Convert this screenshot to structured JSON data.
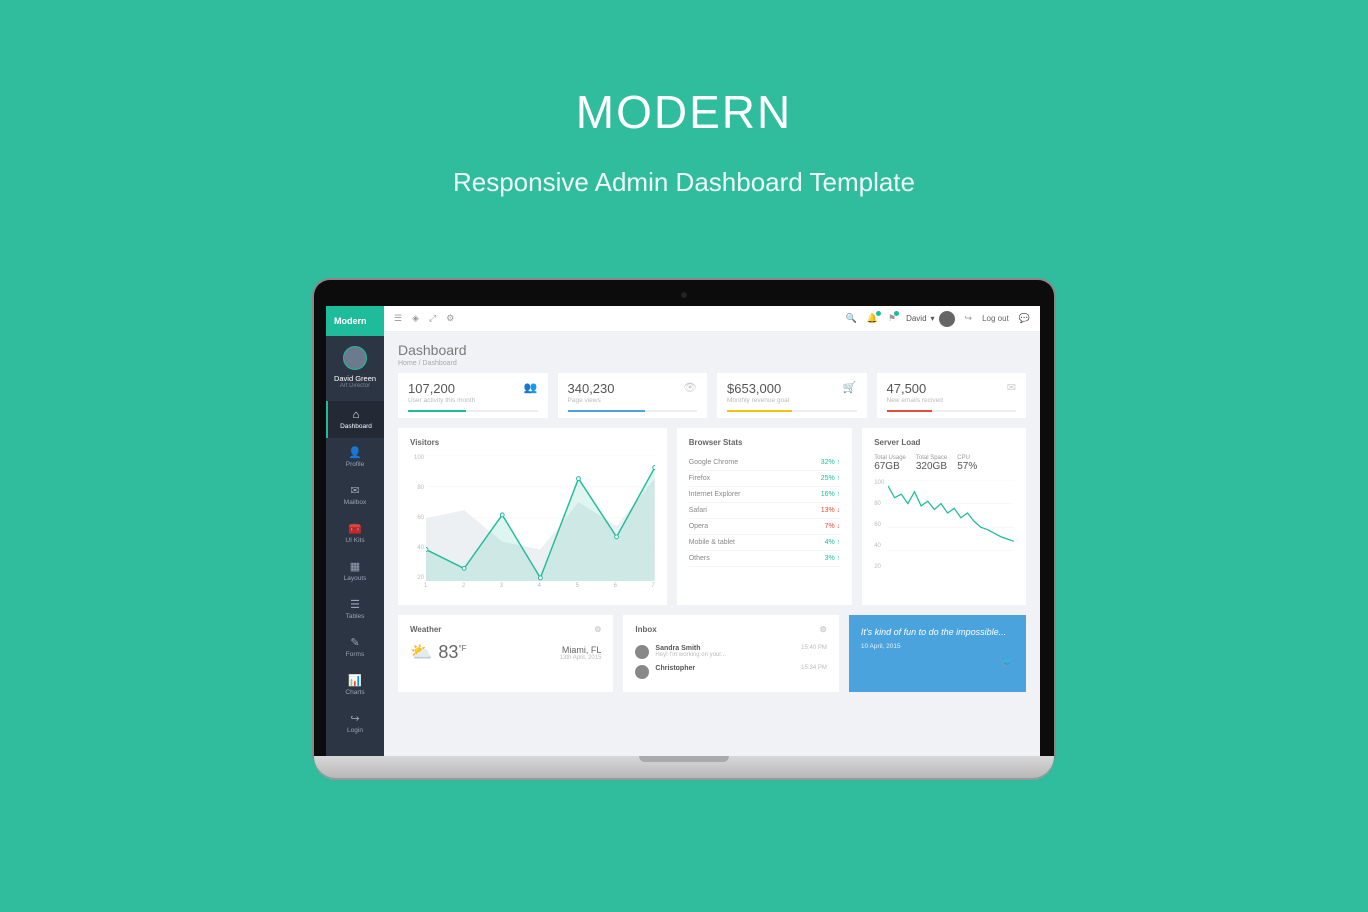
{
  "hero": {
    "title": "MODERN",
    "subtitle": "Responsive Admin Dashboard Template"
  },
  "brand": "Modern",
  "profile": {
    "name": "David Green",
    "role": "Art Director"
  },
  "nav": [
    {
      "label": "Dashboard",
      "icon": "⌂"
    },
    {
      "label": "Profile",
      "icon": "👤"
    },
    {
      "label": "Mailbox",
      "icon": "✉"
    },
    {
      "label": "UI Kits",
      "icon": "🧰"
    },
    {
      "label": "Layouts",
      "icon": "▦"
    },
    {
      "label": "Tables",
      "icon": "☰"
    },
    {
      "label": "Forms",
      "icon": "✎"
    },
    {
      "label": "Charts",
      "icon": "📊"
    },
    {
      "label": "Login",
      "icon": "↪"
    }
  ],
  "topbar": {
    "user": "David",
    "logout": "Log out"
  },
  "page": {
    "title": "Dashboard",
    "breadcrumb_home": "Home",
    "breadcrumb_current": "Dashboard"
  },
  "stats": [
    {
      "value": "107,200",
      "label": "User activity this month",
      "color": "#1fbc9c",
      "pct": 45
    },
    {
      "value": "340,230",
      "label": "Page views",
      "color": "#4ba3dd",
      "pct": 60
    },
    {
      "value": "$653,000",
      "label": "Monthly revenue goal",
      "color": "#f1c40f",
      "pct": 50
    },
    {
      "value": "47,500",
      "label": "New emails recived",
      "color": "#e74c3c",
      "pct": 35
    }
  ],
  "visitors": {
    "title": "Visitors"
  },
  "browsers": {
    "title": "Browser Stats",
    "items": [
      {
        "name": "Google Chrome",
        "pct": "32%",
        "trend": "up"
      },
      {
        "name": "Firefox",
        "pct": "25%",
        "trend": "up"
      },
      {
        "name": "Internet Explorer",
        "pct": "16%",
        "trend": "up"
      },
      {
        "name": "Safari",
        "pct": "13%",
        "trend": "down"
      },
      {
        "name": "Opera",
        "pct": "7%",
        "trend": "down"
      },
      {
        "name": "Mobile & tablet",
        "pct": "4%",
        "trend": "up"
      },
      {
        "name": "Others",
        "pct": "3%",
        "trend": "up"
      }
    ]
  },
  "server": {
    "title": "Server Load",
    "usage_label": "Total Usage",
    "usage": "67GB",
    "space_label": "Total Space",
    "space": "320GB",
    "cpu_label": "CPU",
    "cpu": "57%"
  },
  "weather": {
    "title": "Weather",
    "temp": "83",
    "unit": "°F",
    "city": "Miami, FL",
    "date": "13th April, 2015"
  },
  "inbox": {
    "title": "Inbox",
    "messages": [
      {
        "name": "Sandra Smith",
        "text": "Hey! I'm working on your...",
        "time": "15:40 PM"
      },
      {
        "name": "Christopher",
        "text": "",
        "time": "15:34 PM"
      }
    ]
  },
  "quote": {
    "text": "It's kind of fun to do the impossible...",
    "date": "10 April, 2015"
  },
  "chart_data": [
    {
      "type": "area",
      "title": "Visitors",
      "x": [
        1,
        2,
        3,
        4,
        5,
        6,
        7
      ],
      "series": [
        {
          "name": "secondary",
          "values": [
            60,
            65,
            45,
            40,
            70,
            55,
            85
          ],
          "color": "#e8ecef"
        },
        {
          "name": "primary",
          "values": [
            40,
            28,
            62,
            22,
            85,
            48,
            92
          ],
          "color": "#1fbc9c"
        }
      ],
      "ylim": [
        20,
        100
      ],
      "yticks": [
        100,
        80,
        60,
        40,
        20
      ]
    },
    {
      "type": "line",
      "title": "Server Load",
      "x": [
        0,
        1,
        2,
        3,
        4,
        5,
        6,
        7,
        8,
        9,
        10,
        11,
        12,
        13,
        14,
        15,
        16,
        17,
        18,
        19
      ],
      "values": [
        95,
        85,
        88,
        80,
        90,
        78,
        82,
        75,
        80,
        72,
        76,
        68,
        72,
        65,
        60,
        58,
        55,
        52,
        50,
        48
      ],
      "ylim": [
        20,
        100
      ],
      "yticks": [
        100,
        80,
        60,
        40,
        20
      ],
      "color": "#1fbc9c"
    }
  ]
}
